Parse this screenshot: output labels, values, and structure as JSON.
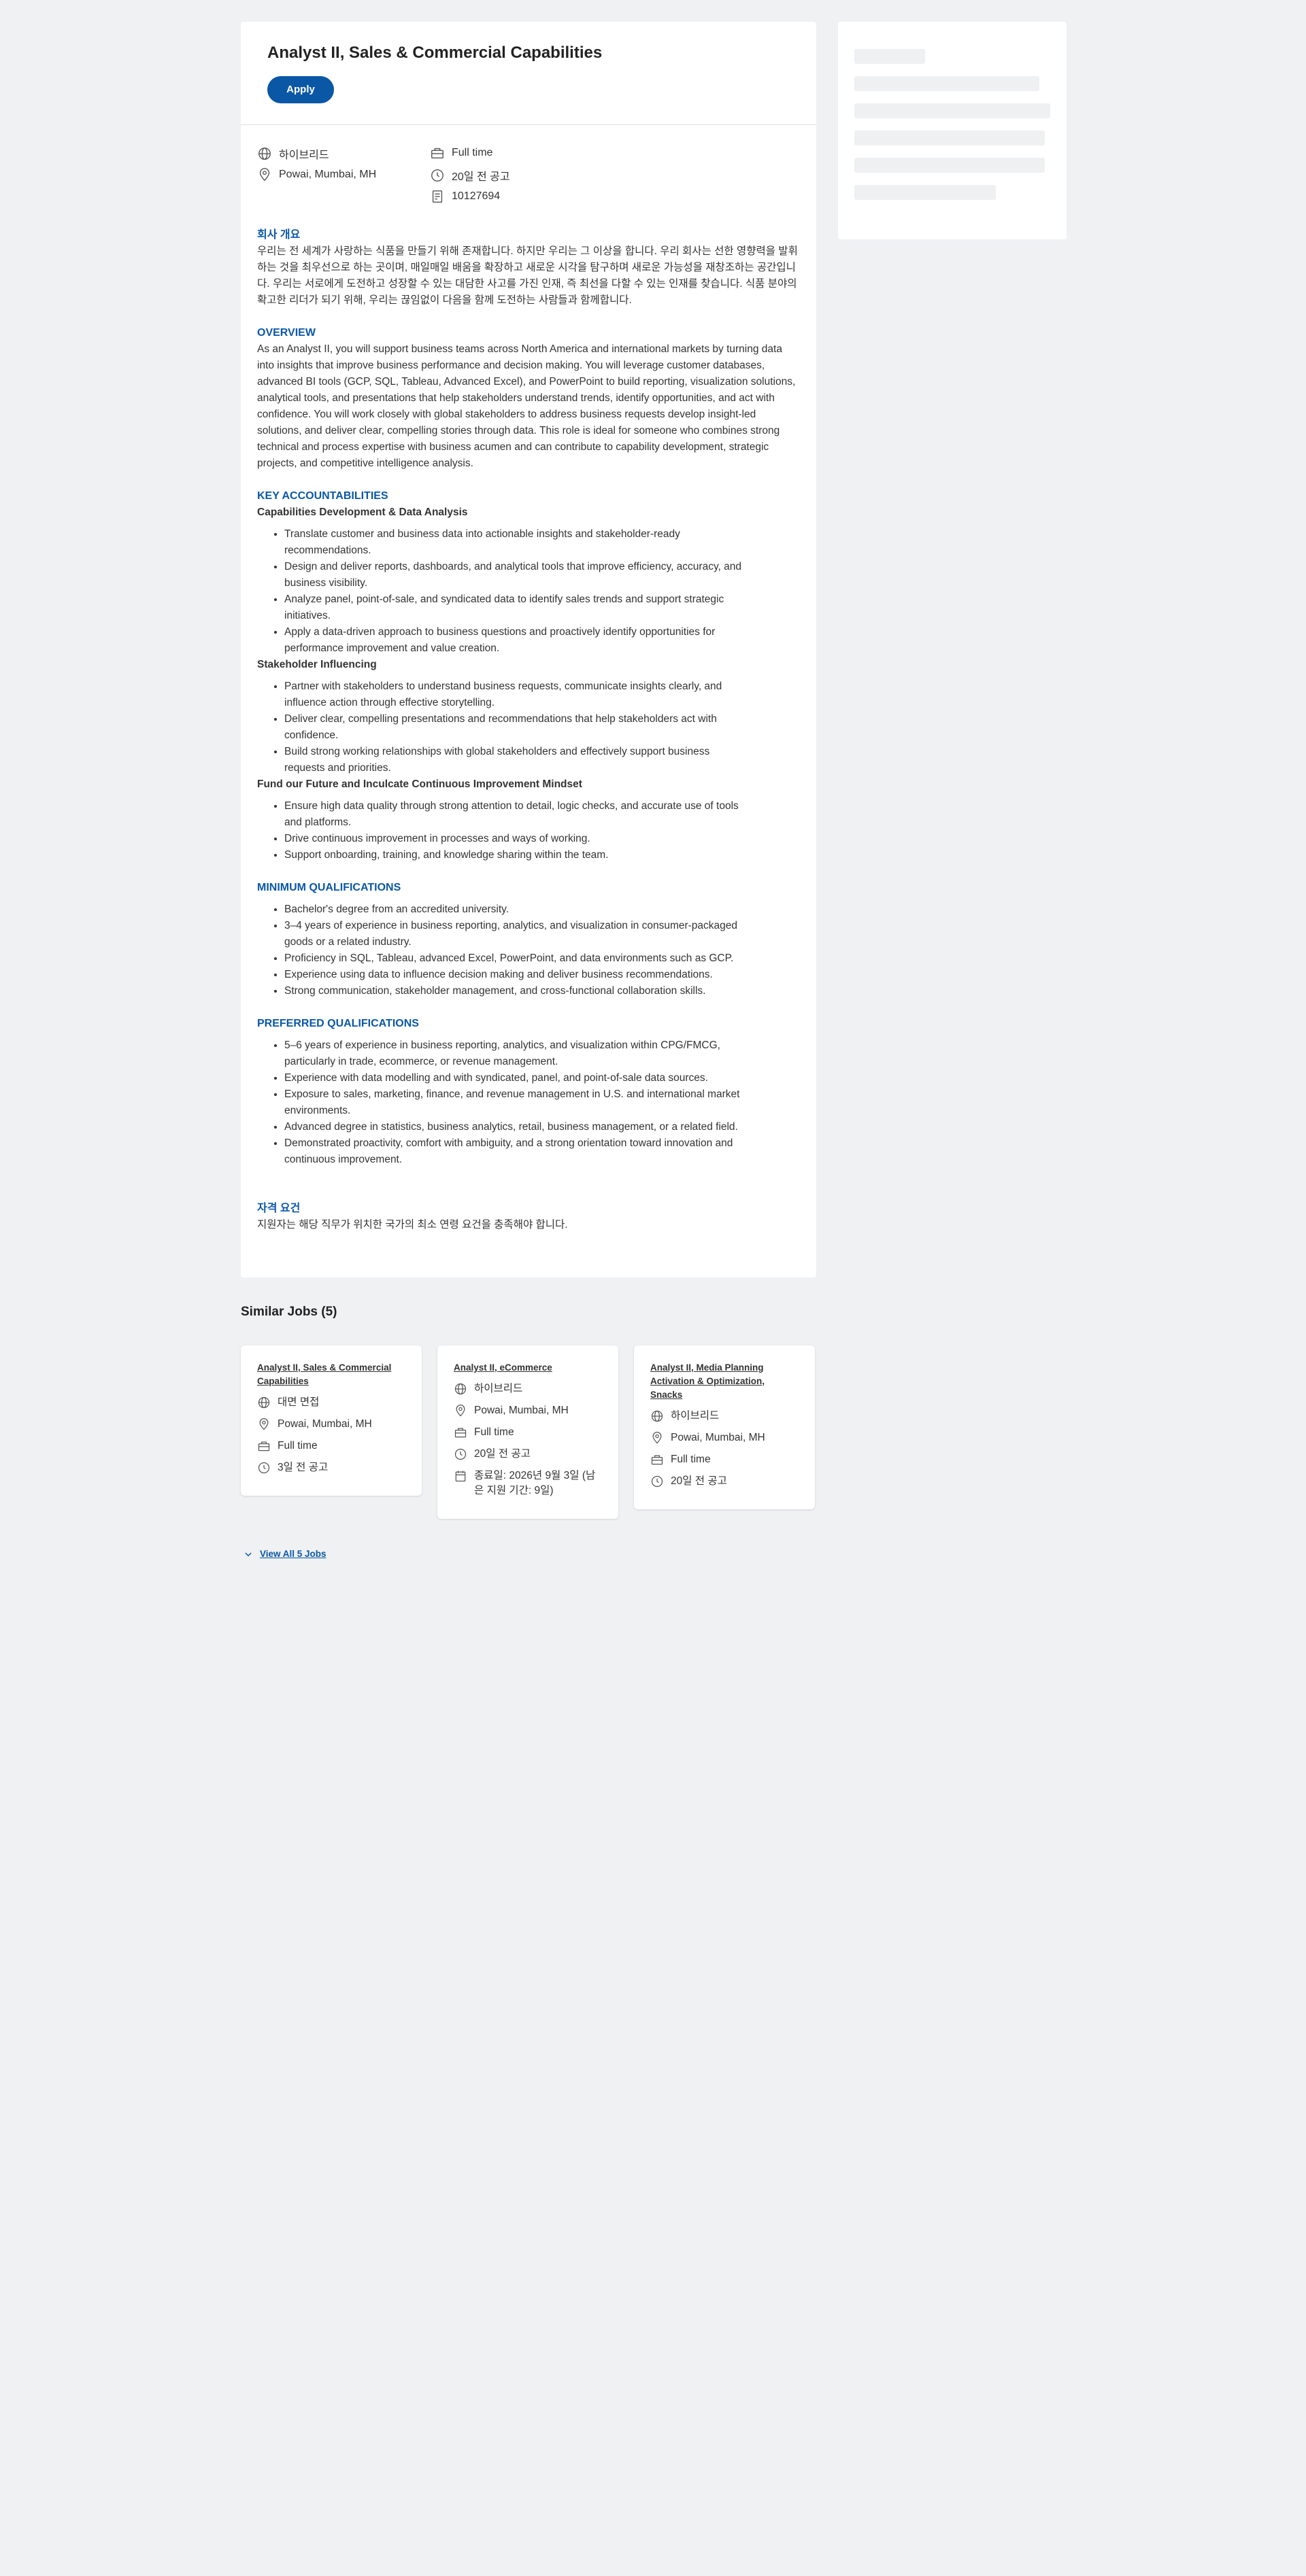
{
  "job": {
    "title": "Analyst II, Sales & Commercial Capabilities",
    "apply_label": "Apply",
    "work_mode": "하이브리드",
    "location": "Powai, Mumbai, MH",
    "time_type": "Full time",
    "posted": "20일 전 공고",
    "req_id": "10127694"
  },
  "about": {
    "heading": "회사 개요",
    "text": "우리는 전 세계가 사랑하는 식품을 만들기 위해 존재합니다. 하지만 우리는 그 이상을 합니다. 우리 회사는 선한 영향력을 발휘하는 것을 최우선으로 하는 곳이며, 매일매일 배움을 확장하고 새로운 시각을 탐구하며 새로운 가능성을 재창조하는 공간입니다. 우리는 서로에게 도전하고 성장할 수 있는 대담한 사고를 가진 인재, 즉 최선을 다할 수 있는 인재를 찾습니다. 식품 분야의 확고한 리더가 되기 위해, 우리는 끊임없이 다음을 함께 도전하는 사람들과 함께합니다."
  },
  "overview": {
    "heading": "OVERVIEW",
    "text": "As an Analyst II, you will support business teams across North America and international markets by turning data into insights that improve business performance and decision making. You will leverage customer databases, advanced BI tools (GCP, SQL, Tableau, Advanced Excel), and PowerPoint to build reporting, visualization solutions, analytical tools, and presentations that help stakeholders understand trends, identify opportunities, and act with confidence. You will work closely with global stakeholders to address business requests develop insight-led solutions, and deliver clear, compelling stories through data. This role is ideal for someone who combines strong technical and process expertise with business acumen and can contribute to capability development, strategic projects, and competitive intelligence analysis."
  },
  "key_accountabilities": {
    "heading": "KEY ACCOUNTABILITIES",
    "groups": [
      {
        "title": "Capabilities Development & Data Analysis",
        "items": [
          "Translate customer and business data into actionable insights and stakeholder-ready recommendations.",
          "Design and deliver reports, dashboards, and analytical tools that improve efficiency, accuracy, and business visibility.",
          "Analyze panel, point-of-sale, and syndicated data to identify sales trends and support strategic initiatives.",
          "Apply a data-driven approach to business questions and proactively identify opportunities for performance improvement and value creation."
        ]
      },
      {
        "title": "Stakeholder Influencing",
        "items": [
          "Partner with stakeholders to understand business requests, communicate insights clearly, and influence action through effective storytelling.",
          "Deliver clear, compelling presentations and recommendations that help stakeholders act with confidence.",
          "Build strong working relationships with global stakeholders and effectively support business requests and priorities."
        ]
      },
      {
        "title": "Fund our Future and Inculcate Continuous Improvement Mindset",
        "items": [
          "Ensure high data quality through strong attention to detail, logic checks, and accurate use of tools and platforms.",
          "Drive continuous improvement in processes and ways of working.",
          "Support onboarding, training, and knowledge sharing within the team."
        ]
      }
    ]
  },
  "min_quals": {
    "heading": "MINIMUM QUALIFICATIONS",
    "items": [
      "Bachelor's degree from an accredited university.",
      "3–4 years of experience in business reporting, analytics, and visualization in consumer-packaged goods or a related industry.",
      "Proficiency in SQL, Tableau, advanced Excel, PowerPoint, and data environments such as GCP.",
      "Experience using data to influence decision making and deliver business recommendations.",
      "Strong communication, stakeholder management, and cross-functional collaboration skills."
    ]
  },
  "pref_quals": {
    "heading": "PREFERRED QUALIFICATIONS",
    "items": [
      "5–6 years of experience in business reporting, analytics, and visualization within CPG/FMCG, particularly in trade, ecommerce, or revenue management.",
      "Experience with data modelling and with syndicated, panel, and point-of-sale data sources.",
      "Exposure to sales, marketing, finance, and revenue management in U.S. and international market environments.",
      "Advanced degree in statistics, business analytics, retail, business management, or a related field.",
      "Demonstrated proactivity, comfort with ambiguity, and a strong orientation toward innovation and continuous improvement."
    ]
  },
  "eligibility": {
    "heading": "자격 요건",
    "text": "지원자는 해당 직무가 위치한 국가의 최소 연령 요건을 충족해야 합니다."
  },
  "similar": {
    "title": "Similar Jobs (5)",
    "view_all": "View All 5 Jobs",
    "cards": [
      {
        "title": "Analyst II, Sales & Commercial Capabilities",
        "work_mode": "대면 면접",
        "location": "Powai, Mumbai, MH",
        "time_type": "Full time",
        "posted": "3일 전 공고"
      },
      {
        "title": "Analyst II, eCommerce",
        "work_mode": "하이브리드",
        "location": "Powai, Mumbai, MH",
        "time_type": "Full time",
        "posted": "20일 전 공고",
        "deadline": "종료일: 2026년 9월 3일 (남은 지원 기간: 9일)"
      },
      {
        "title": "Analyst II, Media Planning Activation & Optimization, Snacks",
        "work_mode": "하이브리드",
        "location": "Powai, Mumbai, MH",
        "time_type": "Full time",
        "posted": "20일 전 공고"
      }
    ]
  },
  "colors": {
    "accent": "#0a57a6",
    "background": "#eff1f3",
    "card": "#ffffff"
  },
  "icons": {
    "globe": "globe-icon",
    "pin": "location-pin-icon",
    "building": "building-icon",
    "clock": "clock-icon",
    "id": "document-id-icon",
    "calendar": "calendar-icon",
    "chevron": "chevron-down-icon"
  }
}
